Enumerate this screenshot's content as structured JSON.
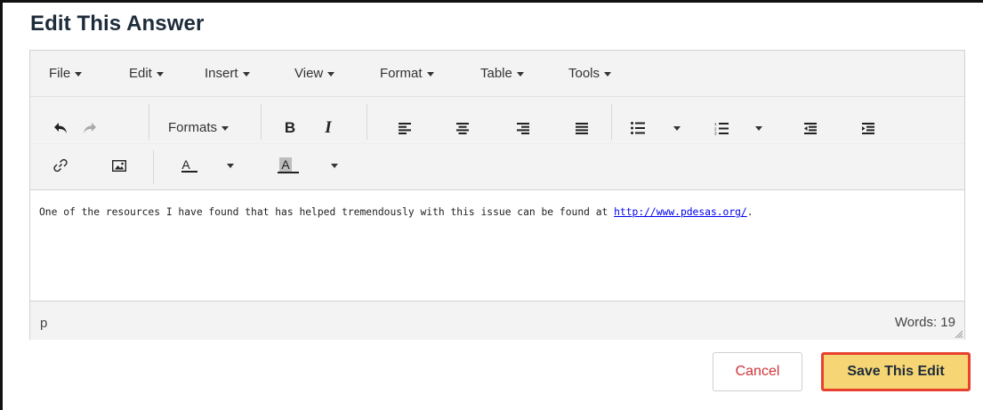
{
  "page": {
    "title": "Edit This Answer"
  },
  "menubar": {
    "file": "File",
    "edit": "Edit",
    "insert": "Insert",
    "view": "View",
    "format": "Format",
    "table": "Table",
    "tools": "Tools"
  },
  "toolbar": {
    "formats_label": "Formats",
    "bold": "B",
    "italic": "I",
    "text_color_sample": "A",
    "bg_color_sample": "A",
    "icons": [
      "undo-icon",
      "redo-icon",
      "bold-icon",
      "italic-icon",
      "align-left-icon",
      "align-center-icon",
      "align-right-icon",
      "justify-icon",
      "bullet-list-icon",
      "numbered-list-icon",
      "outdent-icon",
      "indent-icon",
      "link-icon",
      "image-icon",
      "text-color-icon",
      "background-color-icon"
    ]
  },
  "content": {
    "text_before": "One of the resources I have found that has helped tremendously with this issue can be found at ",
    "link_text": "http://www.pdesas.org/",
    "text_after": "."
  },
  "statusbar": {
    "path": "p",
    "word_count": "Words: 19"
  },
  "actions": {
    "cancel": "Cancel",
    "save": "Save This Edit"
  },
  "colors": {
    "save_bg": "#f6d574",
    "save_border": "#e8412f",
    "cancel_text": "#d0343a",
    "title": "#1d2b3a"
  }
}
